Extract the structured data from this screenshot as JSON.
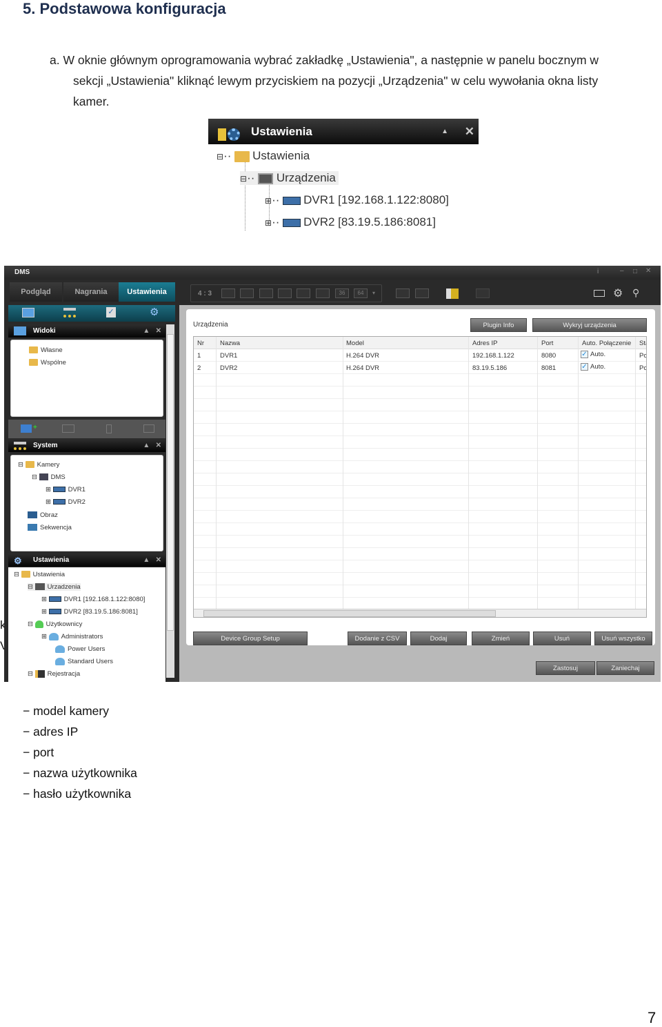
{
  "heading": "5. Podstawowa konfiguracja",
  "instruction": {
    "marker": "a.",
    "line1": "W oknie głównym oprogramowania wybrać zakładkę „Ustawienia\", a następnie w panelu bocznym w",
    "line2": "sekcji „Ustawienia\" kliknąć lewym przyciskiem na pozycji „Urządzenia\" w celu wywołania okna listy",
    "line3": "kamer."
  },
  "snippet": {
    "title": "Ustawienia",
    "root": "Ustawienia",
    "devices": "Urządzenia",
    "dvr1": "DVR1 [192.168.1.122:8080]",
    "dvr2": "DVR2 [83.19.5.186:8081]"
  },
  "app": {
    "title": "DMS",
    "tabs": [
      "Podgląd",
      "Nagrania",
      "Ustawienia"
    ],
    "active_tab": "Ustawienia",
    "aspect": "4 : 3",
    "layout_labels": [
      "36",
      "64"
    ],
    "accent_color": "#14697d",
    "panels": {
      "views": {
        "title": "Widoki",
        "items": [
          "Własne",
          "Wspólne"
        ]
      },
      "system": {
        "title": "System",
        "items": [
          "Kamery",
          "DMS",
          "DVR1",
          "DVR2",
          "Obraz",
          "Sekwencja"
        ]
      },
      "settings": {
        "title": "Ustawienia",
        "items": [
          "Ustawienia",
          "Urzadzenia",
          "DVR1 [192.168.1.122:8080]",
          "DVR2 [83.19.5.186:8081]",
          "Użytkownicy",
          "Administrators",
          "Power Users",
          "Standard Users",
          "Rejestracja"
        ]
      }
    },
    "main": {
      "section_title": "Urządzenia",
      "plugin_info": "Plugin Info",
      "detect": "Wykryj urządzenia",
      "columns": [
        "Nr",
        "Nazwa",
        "Model",
        "Adres IP",
        "Port",
        "Auto. Połączenie",
        "Sta"
      ],
      "rows": [
        {
          "nr": "1",
          "name": "DVR1",
          "model": "H.264 DVR",
          "ip": "192.168.1.122",
          "port": "8080",
          "auto": "Auto.",
          "auto_checked": true,
          "status": "Po"
        },
        {
          "nr": "2",
          "name": "DVR2",
          "model": "H.264 DVR",
          "ip": "83.19.5.186",
          "port": "8081",
          "auto": "Auto.",
          "auto_checked": true,
          "status": "Po"
        }
      ],
      "buttons": [
        "Device Group Setup",
        "Dodanie z CSV",
        "Dodaj",
        "Zmień",
        "Usuń",
        "Usuń wszystko"
      ],
      "apply": "Zastosuj",
      "cancel": "Zaniechaj"
    }
  },
  "occluded_fragments": [
    "k",
    "V"
  ],
  "list": [
    "− model kamery",
    "− adres IP",
    "− port",
    "− nazwa użytkownika",
    "− hasło użytkownika"
  ],
  "page_number": "7"
}
